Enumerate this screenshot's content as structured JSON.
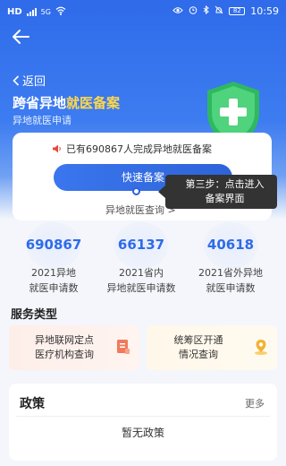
{
  "status_bar": {
    "carrier": "HD",
    "network": "5G",
    "battery": "82",
    "time": "10:59"
  },
  "nav": {
    "back_label": "返回"
  },
  "header": {
    "title_prefix": "跨省异地",
    "title_accent": "就医备案",
    "subtitle": "异地就医申请"
  },
  "card": {
    "notice": "已有690867人完成异地就医备案",
    "quick_button": "快速备案",
    "query_link": "异地就医查询 >"
  },
  "tooltip": {
    "line1": "第三步：点击进入",
    "line2": "备案界面"
  },
  "stats": [
    {
      "value": "690867",
      "label_line1": "2021异地",
      "label_line2": "就医申请数"
    },
    {
      "value": "66137",
      "label_line1": "2021省内",
      "label_line2": "异地就医申请数"
    },
    {
      "value": "40618",
      "label_line1": "2021省外异地",
      "label_line2": "就医申请数"
    }
  ],
  "services": {
    "section_title": "服务类型",
    "items": [
      {
        "line1": "异地联网定点",
        "line2": "医疗机构查询",
        "icon": "document-icon"
      },
      {
        "line1": "统筹区开通",
        "line2": "情况查询",
        "icon": "location-icon"
      }
    ]
  },
  "policy": {
    "title": "政策",
    "more": "更多",
    "empty": "暂无政策"
  },
  "colors": {
    "primary": "#2f6bea",
    "accent": "#ffd84a",
    "shield": "#35c46a"
  }
}
